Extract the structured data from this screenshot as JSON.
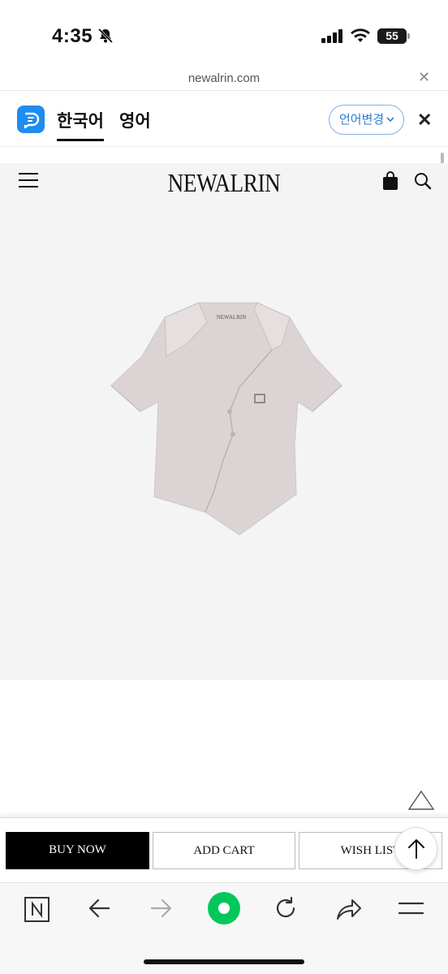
{
  "status_bar": {
    "time": "4:35",
    "battery": "55"
  },
  "url_bar": {
    "url": "newalrin.com"
  },
  "translation_bar": {
    "source_language": "한국어",
    "target_language": "영어",
    "change_language_label": "언어변경"
  },
  "site_header": {
    "brand": "NEWALRIN"
  },
  "product": {
    "label_text": "NEWALRIN"
  },
  "actions": {
    "buy_now": "BUY NOW",
    "add_cart": "ADD CART",
    "wish_list": "WISH LIST"
  },
  "browser_toolbar": {
    "items": [
      "naver-home-icon",
      "back-icon",
      "forward-icon",
      "green-dot-icon",
      "reload-icon",
      "share-icon",
      "menu-icon"
    ]
  },
  "colors": {
    "accent_blue": "#1e8cf0",
    "toolbar_green": "#03c75a",
    "buy_button": "#000000",
    "product_bg": "#f4f4f4"
  }
}
